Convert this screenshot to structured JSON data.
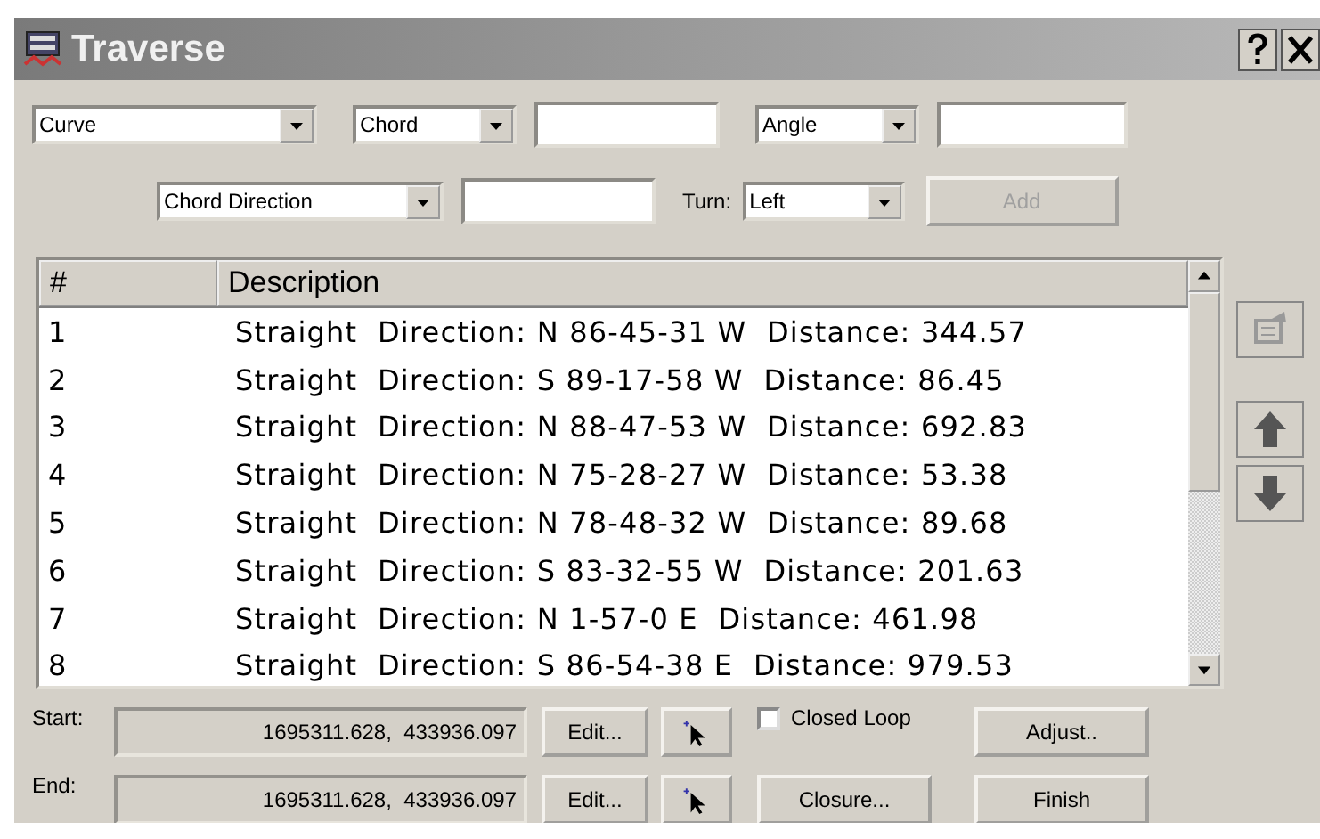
{
  "window": {
    "title": "Traverse"
  },
  "row1": {
    "type_select": "Curve",
    "length_select": "Chord",
    "angle_select": "Angle"
  },
  "row2": {
    "direction_select": "Chord Direction",
    "turn_label": "Turn:",
    "turn_select": "Left",
    "add_button": {
      "label": "Add",
      "disabled": true
    }
  },
  "table": {
    "columns": [
      "#",
      "Description"
    ],
    "rows": [
      {
        "num": "1",
        "description": "Straight  Direction: N 86-45-31 W  Distance: 344.57"
      },
      {
        "num": "2",
        "description": "Straight  Direction: S 89-17-58 W  Distance: 86.45"
      },
      {
        "num": "3",
        "description": "Straight  Direction: N 88-47-53 W  Distance: 692.83"
      },
      {
        "num": "4",
        "description": "Straight  Direction: N 75-28-27 W  Distance: 53.38"
      },
      {
        "num": "5",
        "description": "Straight  Direction: N 78-48-32 W  Distance: 89.68"
      },
      {
        "num": "6",
        "description": "Straight  Direction: S 83-32-55 W  Distance: 201.63"
      },
      {
        "num": "7",
        "description": "Straight  Direction: N 1-57-0 E  Distance: 461.98"
      },
      {
        "num": "8",
        "description": "Straight  Direction: S 86-54-38 E  Distance: 979.53"
      }
    ]
  },
  "start": {
    "label": "Start:",
    "value": "1695311.628,  433936.097",
    "edit_button": "Edit..."
  },
  "end": {
    "label": "End:",
    "value": "1695311.628,  433936.097",
    "edit_button": "Edit..."
  },
  "closed_loop": {
    "label": "Closed Loop",
    "checked": false
  },
  "buttons": {
    "adjust": "Adjust..",
    "closure": "Closure...",
    "finish": "Finish"
  }
}
